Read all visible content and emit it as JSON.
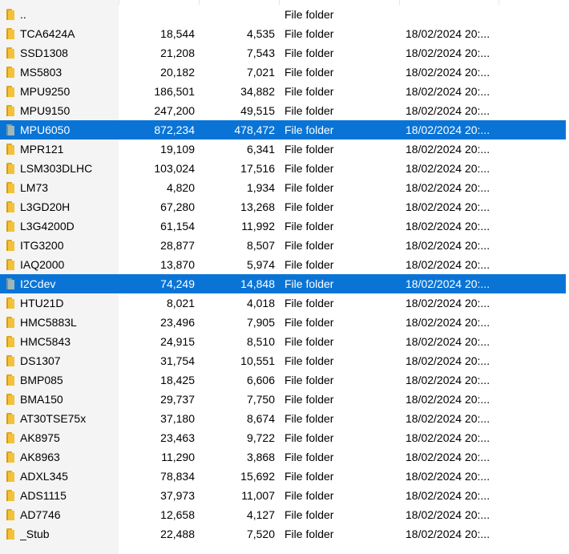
{
  "type_label": "File folder",
  "date_label": "18/02/2024 20:...",
  "colors": {
    "selection": "#0a74d6",
    "folder": "#f3c13a",
    "gutter": "#f4f4f4"
  },
  "rows": [
    {
      "name": "..",
      "files": "",
      "folders": "",
      "type": "File folder",
      "date": "",
      "selected": false
    },
    {
      "name": "TCA6424A",
      "files": "18,544",
      "folders": "4,535",
      "type": "File folder",
      "date": "18/02/2024 20:...",
      "selected": false
    },
    {
      "name": "SSD1308",
      "files": "21,208",
      "folders": "7,543",
      "type": "File folder",
      "date": "18/02/2024 20:...",
      "selected": false
    },
    {
      "name": "MS5803",
      "files": "20,182",
      "folders": "7,021",
      "type": "File folder",
      "date": "18/02/2024 20:...",
      "selected": false
    },
    {
      "name": "MPU9250",
      "files": "186,501",
      "folders": "34,882",
      "type": "File folder",
      "date": "18/02/2024 20:...",
      "selected": false
    },
    {
      "name": "MPU9150",
      "files": "247,200",
      "folders": "49,515",
      "type": "File folder",
      "date": "18/02/2024 20:...",
      "selected": false
    },
    {
      "name": "MPU6050",
      "files": "872,234",
      "folders": "478,472",
      "type": "File folder",
      "date": "18/02/2024 20:...",
      "selected": true
    },
    {
      "name": "MPR121",
      "files": "19,109",
      "folders": "6,341",
      "type": "File folder",
      "date": "18/02/2024 20:...",
      "selected": false
    },
    {
      "name": "LSM303DLHC",
      "files": "103,024",
      "folders": "17,516",
      "type": "File folder",
      "date": "18/02/2024 20:...",
      "selected": false
    },
    {
      "name": "LM73",
      "files": "4,820",
      "folders": "1,934",
      "type": "File folder",
      "date": "18/02/2024 20:...",
      "selected": false
    },
    {
      "name": "L3GD20H",
      "files": "67,280",
      "folders": "13,268",
      "type": "File folder",
      "date": "18/02/2024 20:...",
      "selected": false
    },
    {
      "name": "L3G4200D",
      "files": "61,154",
      "folders": "11,992",
      "type": "File folder",
      "date": "18/02/2024 20:...",
      "selected": false
    },
    {
      "name": "ITG3200",
      "files": "28,877",
      "folders": "8,507",
      "type": "File folder",
      "date": "18/02/2024 20:...",
      "selected": false
    },
    {
      "name": "IAQ2000",
      "files": "13,870",
      "folders": "5,974",
      "type": "File folder",
      "date": "18/02/2024 20:...",
      "selected": false
    },
    {
      "name": "I2Cdev",
      "files": "74,249",
      "folders": "14,848",
      "type": "File folder",
      "date": "18/02/2024 20:...",
      "selected": true
    },
    {
      "name": "HTU21D",
      "files": "8,021",
      "folders": "4,018",
      "type": "File folder",
      "date": "18/02/2024 20:...",
      "selected": false
    },
    {
      "name": "HMC5883L",
      "files": "23,496",
      "folders": "7,905",
      "type": "File folder",
      "date": "18/02/2024 20:...",
      "selected": false
    },
    {
      "name": "HMC5843",
      "files": "24,915",
      "folders": "8,510",
      "type": "File folder",
      "date": "18/02/2024 20:...",
      "selected": false
    },
    {
      "name": "DS1307",
      "files": "31,754",
      "folders": "10,551",
      "type": "File folder",
      "date": "18/02/2024 20:...",
      "selected": false
    },
    {
      "name": "BMP085",
      "files": "18,425",
      "folders": "6,606",
      "type": "File folder",
      "date": "18/02/2024 20:...",
      "selected": false
    },
    {
      "name": "BMA150",
      "files": "29,737",
      "folders": "7,750",
      "type": "File folder",
      "date": "18/02/2024 20:...",
      "selected": false
    },
    {
      "name": "AT30TSE75x",
      "files": "37,180",
      "folders": "8,674",
      "type": "File folder",
      "date": "18/02/2024 20:...",
      "selected": false
    },
    {
      "name": "AK8975",
      "files": "23,463",
      "folders": "9,722",
      "type": "File folder",
      "date": "18/02/2024 20:...",
      "selected": false
    },
    {
      "name": "AK8963",
      "files": "11,290",
      "folders": "3,868",
      "type": "File folder",
      "date": "18/02/2024 20:...",
      "selected": false
    },
    {
      "name": "ADXL345",
      "files": "78,834",
      "folders": "15,692",
      "type": "File folder",
      "date": "18/02/2024 20:...",
      "selected": false
    },
    {
      "name": "ADS1115",
      "files": "37,973",
      "folders": "11,007",
      "type": "File folder",
      "date": "18/02/2024 20:...",
      "selected": false
    },
    {
      "name": "AD7746",
      "files": "12,658",
      "folders": "4,127",
      "type": "File folder",
      "date": "18/02/2024 20:...",
      "selected": false
    },
    {
      "name": "_Stub",
      "files": "22,488",
      "folders": "7,520",
      "type": "File folder",
      "date": "18/02/2024 20:...",
      "selected": false
    }
  ]
}
